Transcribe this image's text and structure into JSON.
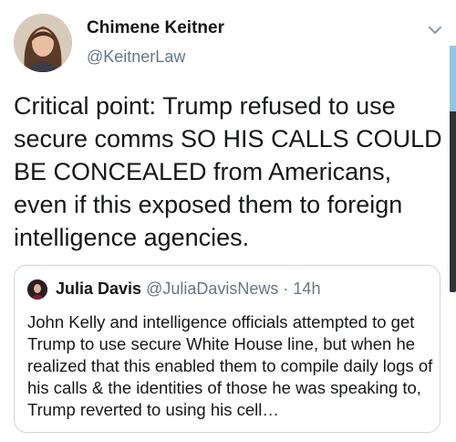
{
  "author": {
    "name": "Chimene Keitner",
    "handle": "@KeitnerLaw"
  },
  "tweet_text": "Critical point: Trump refused to use secure comms SO HIS CALLS COULD BE CONCEALED from Americans, even if this exposed them to foreign intelligence agencies.",
  "quoted_tweet": {
    "name": "Julia Davis",
    "handle": "@JuliaDavisNews",
    "separator": "·",
    "time": "14h",
    "text": "John Kelly and intelligence officials attempted to get Trump to use secure White House line, but when he realized that this enabled them to compile daily logs of his calls & the identities of those he was speaking to, Trump reverted to using his cell…"
  },
  "icons": {
    "menu": "chevron-down-icon"
  },
  "colors": {
    "text": "#14171a",
    "secondary": "#657786",
    "border": "#ccd6dd"
  }
}
